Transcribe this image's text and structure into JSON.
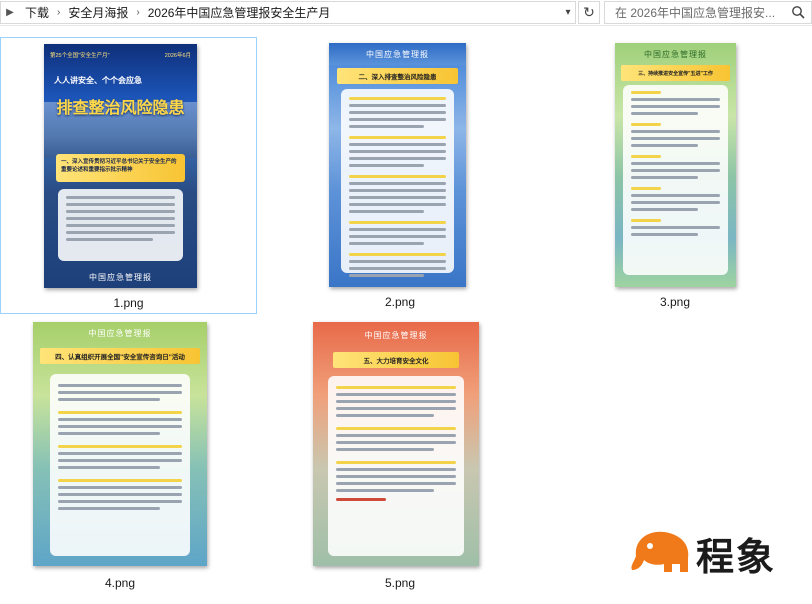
{
  "address": {
    "segments": [
      "下载",
      "安全月海报",
      "2026年中国应急管理报安全生产月"
    ],
    "search_placeholder": "在 2026年中国应急管理报安..."
  },
  "files": [
    {
      "name": "1.png",
      "selected": true,
      "poster": {
        "top_left": "第25个全国\"安全生产月\"",
        "top_right": "2026年6月",
        "slogan": "人人讲安全、个个会应急",
        "headline": "排查整治风险隐患",
        "section": "一、深入宣传贯彻习近平总书记关于安全生产的重要论述和重要指示批示精神",
        "logo": "中国应急管理报"
      }
    },
    {
      "name": "2.png",
      "selected": false,
      "poster": {
        "section": "二、深入排查整治风险隐患"
      }
    },
    {
      "name": "3.png",
      "selected": false,
      "poster": {
        "section": "三、持续推进安全宣传\"五进\"工作"
      }
    },
    {
      "name": "4.png",
      "selected": false,
      "poster": {
        "section": "四、认真组织开展全国\"安全宣传咨询日\"活动",
        "logo": "中国应急管理报"
      }
    },
    {
      "name": "5.png",
      "selected": false,
      "poster": {
        "section": "五、大力培育安全文化",
        "logo": "中国应急管理报"
      }
    }
  ],
  "watermark": {
    "text": "程象"
  },
  "colors": {
    "selection_border": "#99d1ff",
    "highlight": "#f3d34a",
    "accent_red": "#d04a3a"
  }
}
